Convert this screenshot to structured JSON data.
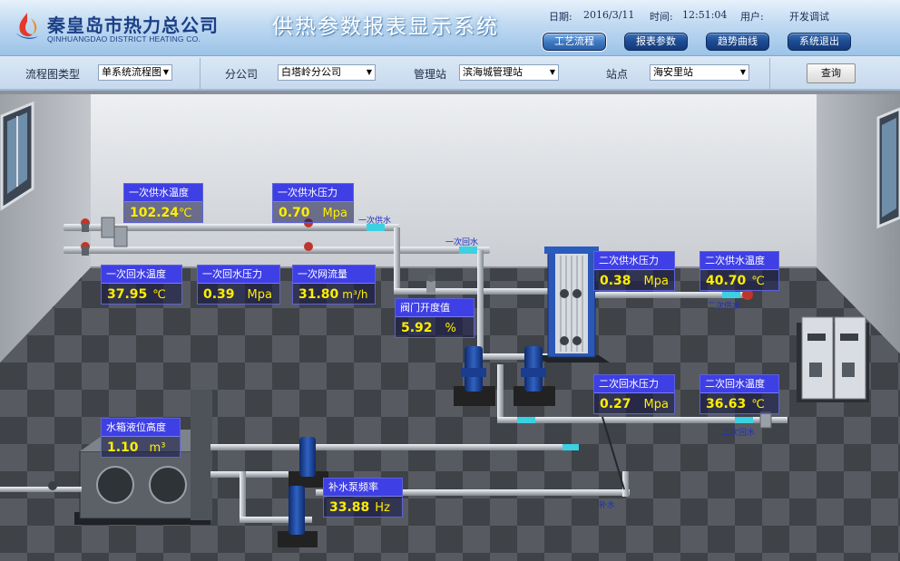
{
  "header": {
    "company_cn": "秦皇岛市热力总公司",
    "company_en": "QINHUANGDAO DISTRICT HEATING CO.",
    "system_title": "供热参数报表显示系统",
    "date_label": "日期:",
    "date_value": "2016/3/11",
    "time_label": "时间:",
    "time_value": "12:51:04",
    "user_label": "用户:",
    "user_value": "开发调试"
  },
  "nav": [
    {
      "label": "工艺流程"
    },
    {
      "label": "报表参数"
    },
    {
      "label": "趋势曲线"
    },
    {
      "label": "系统退出"
    }
  ],
  "filters": {
    "diagram_type_label": "流程图类型",
    "diagram_type_value": "单系统流程图",
    "branch_label": "分公司",
    "branch_value": "白塔岭分公司",
    "station_mgmt_label": "管理站",
    "station_mgmt_value": "滨海城管理站",
    "station_label": "站点",
    "station_value": "海安里站",
    "query_label": "查询"
  },
  "panels": {
    "primary_supply_temp": {
      "label": "一次供水温度",
      "value": "102.24",
      "unit": "℃"
    },
    "primary_supply_pressure": {
      "label": "一次供水压力",
      "value": "0.70",
      "unit": "Mpa"
    },
    "primary_return_temp": {
      "label": "一次回水温度",
      "value": "37.95",
      "unit": "℃"
    },
    "primary_return_pressure": {
      "label": "一次回水压力",
      "value": "0.39",
      "unit": "Mpa"
    },
    "primary_flow": {
      "label": "一次网流量",
      "value": "31.80",
      "unit": "m³/h"
    },
    "valve_opening": {
      "label": "阀门开度值",
      "value": "5.92",
      "unit": "%"
    },
    "secondary_supply_pressure": {
      "label": "二次供水压力",
      "value": "0.38",
      "unit": "Mpa"
    },
    "secondary_supply_temp": {
      "label": "二次供水温度",
      "value": "40.70",
      "unit": "℃"
    },
    "secondary_return_pressure": {
      "label": "二次回水压力",
      "value": "0.27",
      "unit": "Mpa"
    },
    "secondary_return_temp": {
      "label": "二次回水温度",
      "value": "36.63",
      "unit": "℃"
    },
    "tank_level": {
      "label": "水箱液位高度",
      "value": "1.10",
      "unit": "m³"
    },
    "makeup_pump_freq": {
      "label": "补水泵频率",
      "value": "33.88",
      "unit": "Hz"
    }
  },
  "pipe_tags": {
    "primary_supply": "一次供水",
    "primary_return": "一次回水",
    "secondary_supply": "二次供水",
    "secondary_return": "二次回水",
    "makeup": "补水"
  },
  "colors": {
    "panel_label_bg": "#3f3fe6",
    "panel_value_text": "#ffee00",
    "nav_button": "#1d4a90"
  }
}
